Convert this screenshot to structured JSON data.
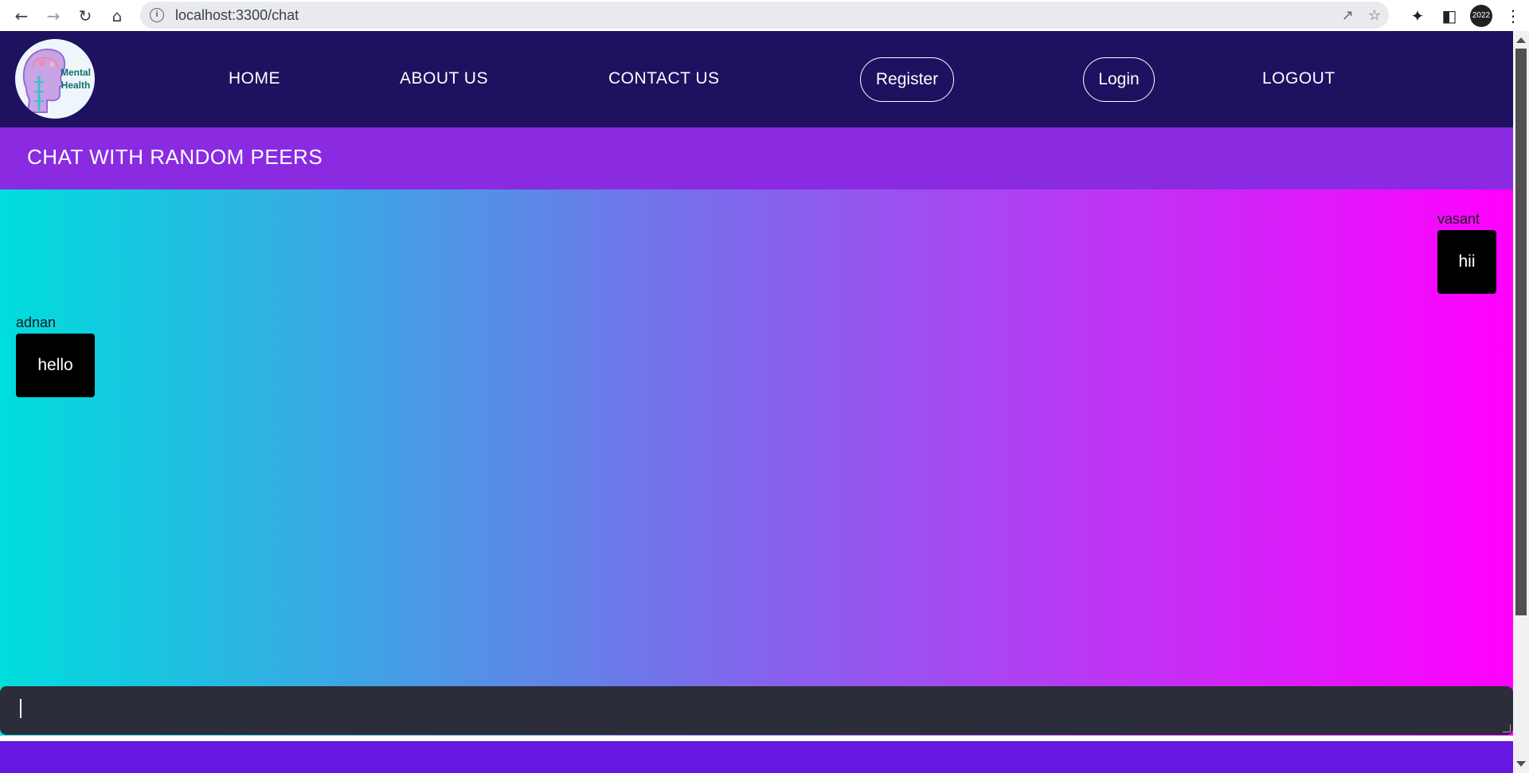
{
  "browser": {
    "url": "localhost:3300/chat",
    "profile_label": "2022"
  },
  "header": {
    "logo_text_line1": "Mental",
    "logo_text_line2": "Health",
    "nav": {
      "home": "HOME",
      "about": "ABOUT US",
      "contact": "CONTACT US",
      "register": "Register",
      "login": "Login",
      "logout": "LOGOUT"
    }
  },
  "page": {
    "title": "CHAT WITH RANDOM PEERS"
  },
  "messages": [
    {
      "sender": "vasant",
      "text": "hii",
      "side": "right"
    },
    {
      "sender": "adnan",
      "text": "hello",
      "side": "left"
    }
  ],
  "composer": {
    "value": ""
  },
  "colors": {
    "header_bg": "#1d1160",
    "title_bar_bg": "#8a2be2",
    "gradient_start": "#00dddd",
    "gradient_end": "#ff00ff",
    "composer_bg": "#2b2d3a",
    "footer_bg": "#6618e0"
  }
}
